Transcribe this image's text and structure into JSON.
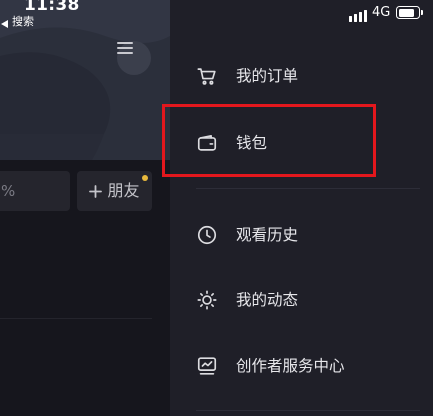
{
  "status_bar": {
    "time": "11:38",
    "back_icon": "back-triangle-icon",
    "back_label": "搜索",
    "signal_icon": "signal-icon",
    "network": "4G",
    "battery_icon": "battery-icon",
    "battery_level": 0.8
  },
  "profile": {
    "menu_icon": "hamburger-menu-icon",
    "stat_text": "%",
    "add_friend": {
      "icon": "plus-icon",
      "label": "朋友"
    }
  },
  "drawer": {
    "items": [
      {
        "icon": "cart-icon",
        "label": "我的订单"
      },
      {
        "icon": "wallet-icon",
        "label": "钱包"
      },
      {
        "icon": "clock-icon",
        "label": "观看历史"
      },
      {
        "icon": "activity-icon",
        "label": "我的动态"
      },
      {
        "icon": "creator-chart-icon",
        "label": "创作者服务中心"
      }
    ]
  },
  "colors": {
    "drawer_background": "#1f1f28",
    "drawer_text": "#e6e6ea",
    "highlight": "#e3171d",
    "notification_dot": "#e8b93c"
  }
}
